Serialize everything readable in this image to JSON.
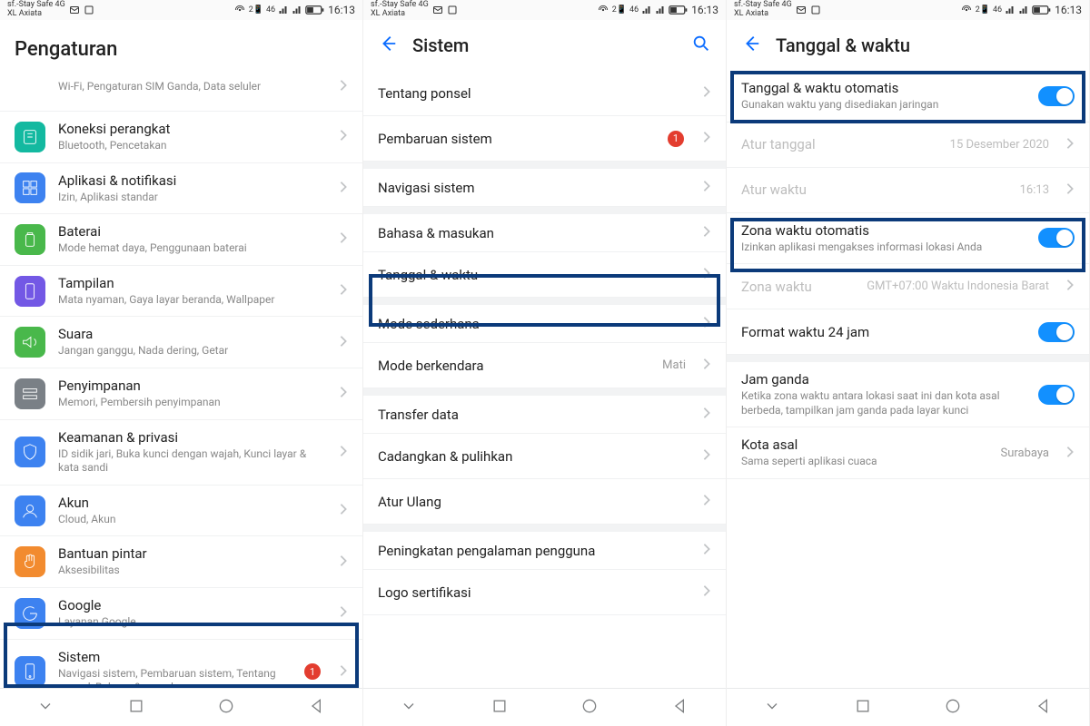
{
  "status": {
    "carrier1": "sf.-Stay Safe 4G",
    "carrier2": "XL Axiata",
    "time": "16:13",
    "net_label": "46"
  },
  "screen1": {
    "title": "Pengaturan",
    "items": [
      {
        "title": "",
        "sub": "Wi-Fi, Pengaturan SIM Ganda, Data seluler"
      },
      {
        "title": "Koneksi perangkat",
        "sub": "Bluetooth, Pencetakan"
      },
      {
        "title": "Aplikasi & notifikasi",
        "sub": "Izin, Aplikasi standar"
      },
      {
        "title": "Baterai",
        "sub": "Mode hemat daya, Penggunaan baterai"
      },
      {
        "title": "Tampilan",
        "sub": "Mata nyaman, Gaya layar beranda, Wallpaper"
      },
      {
        "title": "Suara",
        "sub": "Jangan ganggu, Nada dering, Getar"
      },
      {
        "title": "Penyimpanan",
        "sub": "Memori, Pembersih penyimpanan"
      },
      {
        "title": "Keamanan & privasi",
        "sub": "ID sidik jari, Buka kunci dengan wajah, Kunci layar & kata sandi"
      },
      {
        "title": "Akun",
        "sub": "Cloud, Akun"
      },
      {
        "title": "Bantuan pintar",
        "sub": "Aksesibilitas"
      },
      {
        "title": "Google",
        "sub": "Layanan Google"
      },
      {
        "title": "Sistem",
        "sub": "Navigasi sistem, Pembaruan sistem, Tentang ponsel, Bahasa & masukan",
        "badge": "1"
      }
    ]
  },
  "screen2": {
    "title": "Sistem",
    "items": [
      {
        "title": "Tentang ponsel"
      },
      {
        "title": "Pembaruan sistem",
        "badge": "1"
      },
      {
        "title": "Navigasi sistem",
        "gap": true
      },
      {
        "title": "Bahasa & masukan",
        "gap": true
      },
      {
        "title": "Tanggal & waktu",
        "highlight": true
      },
      {
        "title": "Mode sederhana",
        "gap": true
      },
      {
        "title": "Mode berkendara",
        "value": "Mati"
      },
      {
        "title": "Transfer data",
        "gap": true
      },
      {
        "title": "Cadangkan & pulihkan"
      },
      {
        "title": "Atur Ulang"
      },
      {
        "title": "Peningkatan pengalaman pengguna",
        "gap": true
      },
      {
        "title": "Logo sertifikasi"
      }
    ]
  },
  "screen3": {
    "title": "Tanggal & waktu",
    "auto_dt": {
      "title": "Tanggal & waktu otomatis",
      "sub": "Gunakan waktu yang disediakan jaringan"
    },
    "set_date": {
      "title": "Atur tanggal",
      "value": "15 Desember 2020"
    },
    "set_time": {
      "title": "Atur waktu",
      "value": "16:13"
    },
    "auto_tz": {
      "title": "Zona waktu otomatis",
      "sub": "Izinkan aplikasi mengakses informasi lokasi Anda"
    },
    "tz": {
      "title": "Zona waktu",
      "value": "GMT+07:00 Waktu Indonesia Barat"
    },
    "fmt24": {
      "title": "Format waktu 24 jam"
    },
    "dual": {
      "title": "Jam ganda",
      "sub": "Ketika zona waktu antara lokasi saat ini dan kota asal berbeda, tampilkan jam ganda pada layar kunci"
    },
    "home_city": {
      "title": "Kota asal",
      "sub": "Sama seperti aplikasi cuaca",
      "value": "Surabaya"
    }
  }
}
